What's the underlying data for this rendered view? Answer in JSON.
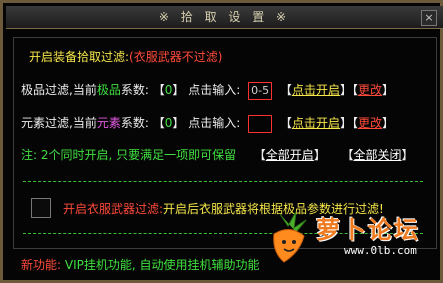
{
  "window": {
    "title": "※ 拾 取 设 置 ※",
    "close": "×"
  },
  "main": {
    "heading": "开启装备拾取过滤:",
    "heading_note": "(衣服武器不过滤)"
  },
  "quality": {
    "label_a": "极品过滤,当前",
    "label_hl": "极品",
    "label_b": "系数:",
    "value": "0",
    "input_label": "点击输入:",
    "input_value": "0-5",
    "enable": "点击开启",
    "change": "更改"
  },
  "element": {
    "label_a": "元素过滤,当前",
    "label_hl": "元素",
    "label_b": "系数:",
    "value": "0",
    "input_label": "点击输入:",
    "input_value": "",
    "enable": "点击开启",
    "change": "更改"
  },
  "note": {
    "text": "注: 2个同时开启, 只要满足一项即可保留",
    "all_on": "全部开启",
    "all_off": "全部关闭"
  },
  "clothes": {
    "label": "开启衣服武器过滤:",
    "desc": "开启后衣服武器将根据极品参数进行过滤!"
  },
  "footer": {
    "label": "新功能:",
    "text": "VIP挂机功能, 自动使用挂机辅助功能"
  },
  "watermark": {
    "logo": "萝卜论坛",
    "url": "www.0lb.com"
  }
}
